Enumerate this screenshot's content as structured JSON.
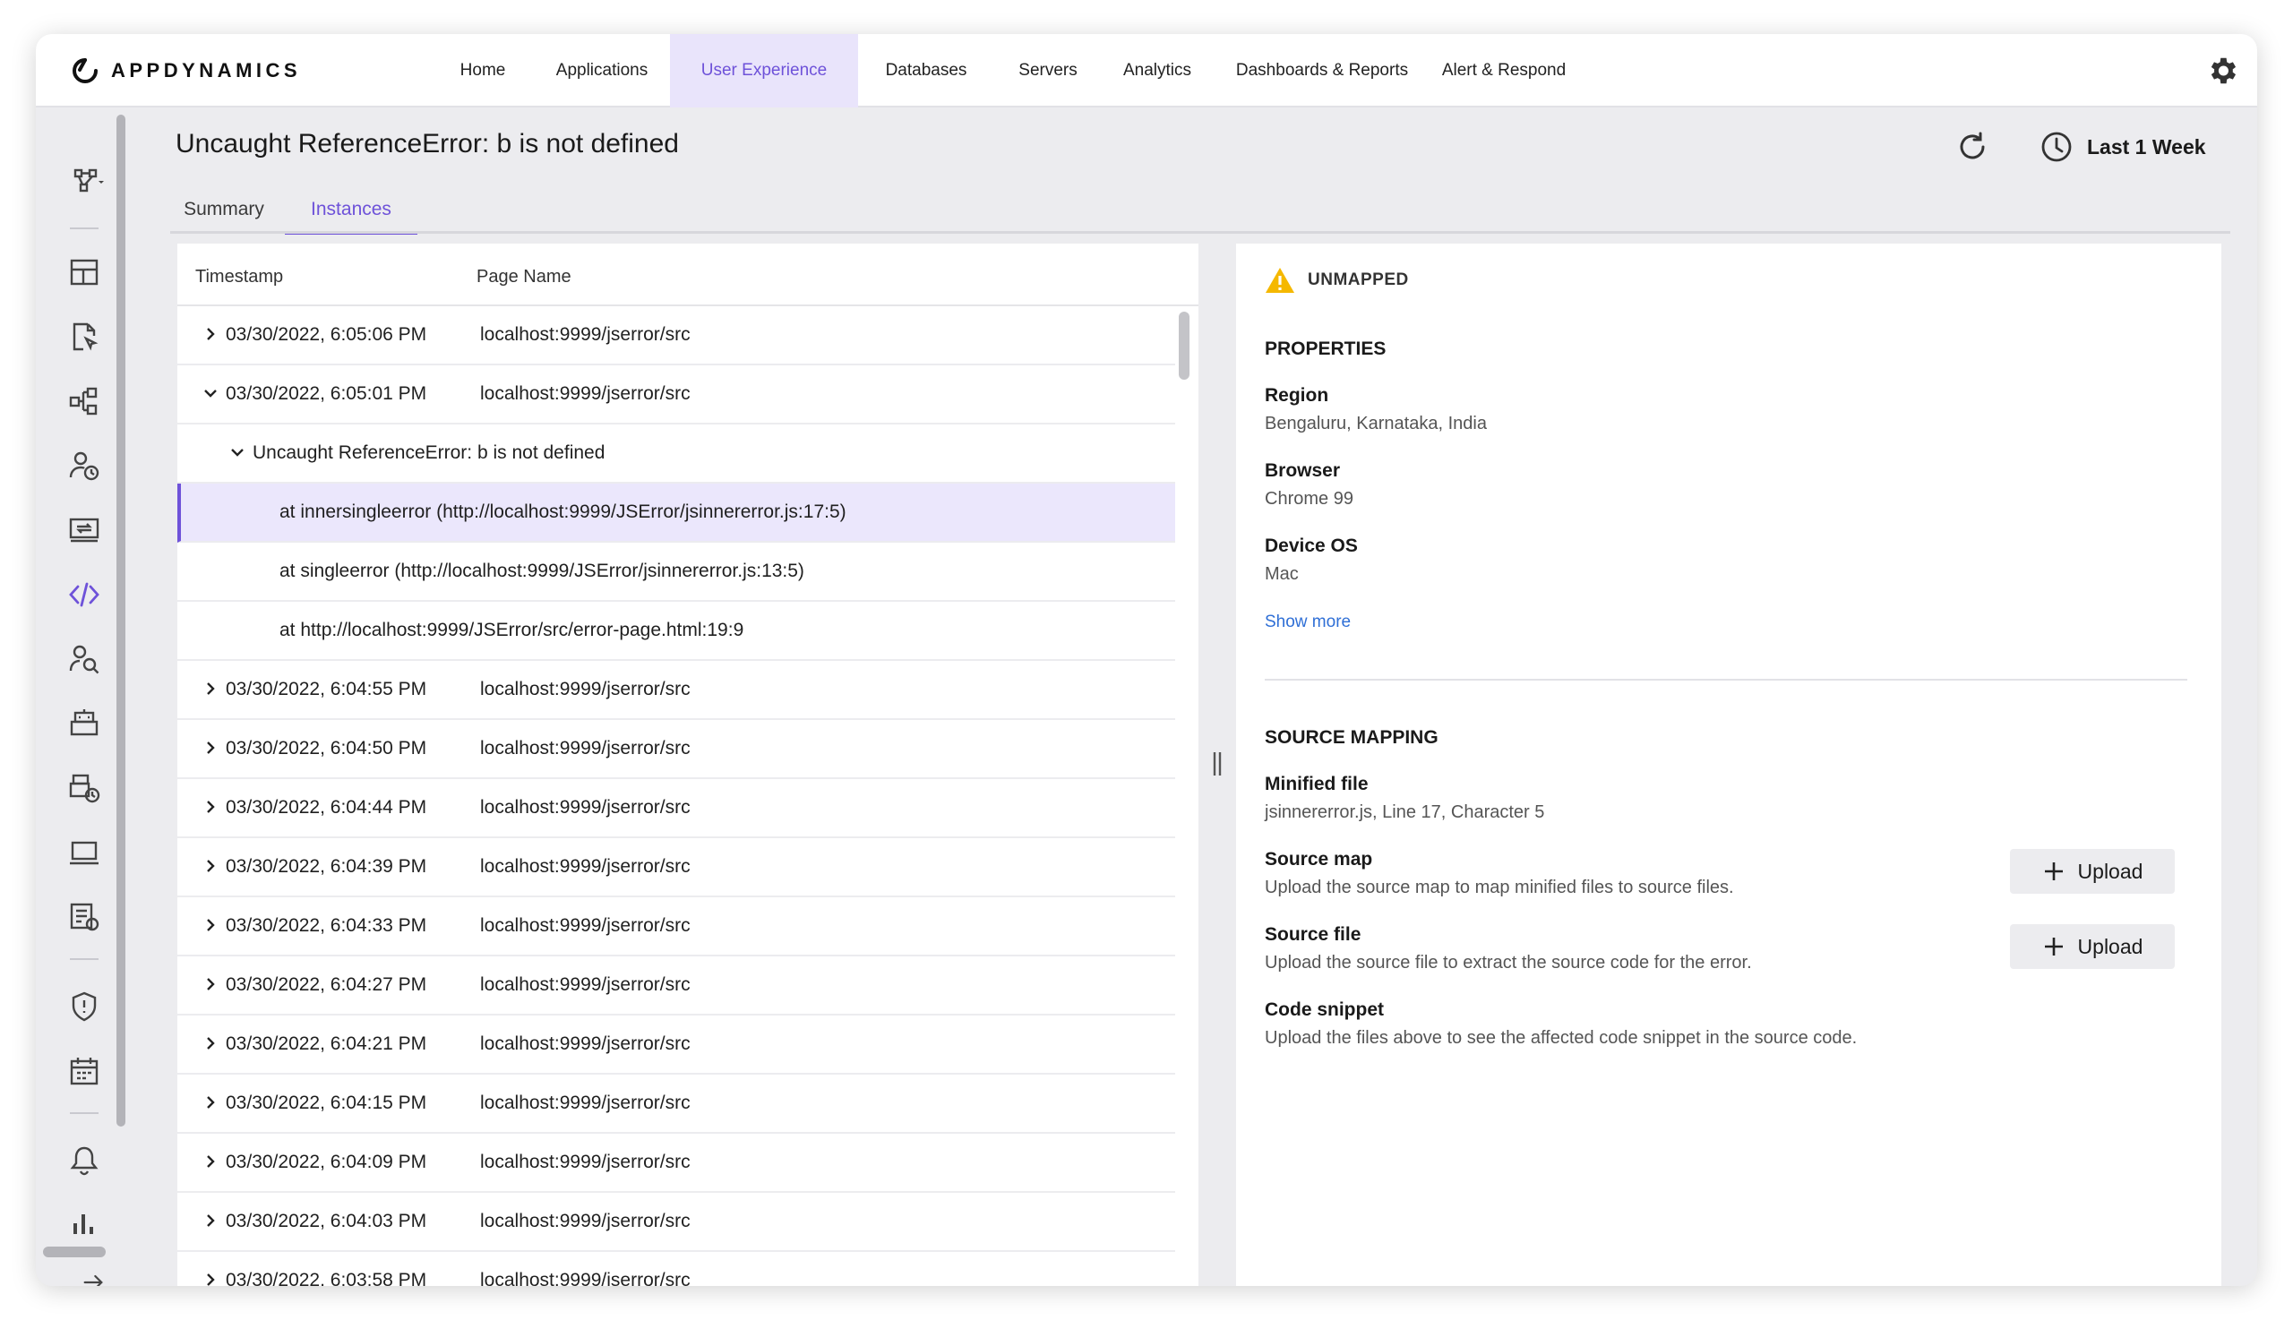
{
  "app": {
    "logo_text": "APPDYNAMICS"
  },
  "nav": {
    "items": [
      {
        "label": "Home"
      },
      {
        "label": "Applications"
      },
      {
        "label": "User Experience"
      },
      {
        "label": "Databases"
      },
      {
        "label": "Servers"
      },
      {
        "label": "Analytics"
      },
      {
        "label": "Dashboards & Reports"
      },
      {
        "label": "Alert & Respond"
      }
    ],
    "active": "User Experience"
  },
  "rail": {
    "icons": [
      "flow-map-icon",
      "dashboard-layout-icon",
      "page-pointer-icon",
      "hierarchy-icon",
      "user-time-icon",
      "screen-switch-icon",
      "code-icon",
      "user-search-icon",
      "robot-icon",
      "robot-time-icon",
      "laptop-icon",
      "report-icon",
      "shield-icon",
      "calendar-icon",
      "alert-bell-icon",
      "bar-chart-icon",
      "expand-arrow-icon"
    ]
  },
  "header": {
    "title": "Uncaught ReferenceError: b is not defined",
    "time_range": "Last 1 Week"
  },
  "tabs": [
    {
      "label": "Summary"
    },
    {
      "label": "Instances"
    }
  ],
  "table": {
    "columns": [
      "Timestamp",
      "Page Name"
    ],
    "rows": [
      {
        "timestamp": "03/30/2022, 6:05:06 PM",
        "page": "localhost:9999/jserror/src"
      },
      {
        "timestamp": "03/30/2022, 6:05:01 PM",
        "page": "localhost:9999/jserror/src"
      },
      {
        "timestamp": "03/30/2022, 6:04:55 PM",
        "page": "localhost:9999/jserror/src"
      },
      {
        "timestamp": "03/30/2022, 6:04:50 PM",
        "page": "localhost:9999/jserror/src"
      },
      {
        "timestamp": "03/30/2022, 6:04:44 PM",
        "page": "localhost:9999/jserror/src"
      },
      {
        "timestamp": "03/30/2022, 6:04:39 PM",
        "page": "localhost:9999/jserror/src"
      },
      {
        "timestamp": "03/30/2022, 6:04:33 PM",
        "page": "localhost:9999/jserror/src"
      },
      {
        "timestamp": "03/30/2022, 6:04:27 PM",
        "page": "localhost:9999/jserror/src"
      },
      {
        "timestamp": "03/30/2022, 6:04:21 PM",
        "page": "localhost:9999/jserror/src"
      },
      {
        "timestamp": "03/30/2022, 6:04:15 PM",
        "page": "localhost:9999/jserror/src"
      },
      {
        "timestamp": "03/30/2022, 6:04:09 PM",
        "page": "localhost:9999/jserror/src"
      },
      {
        "timestamp": "03/30/2022, 6:04:03 PM",
        "page": "localhost:9999/jserror/src"
      },
      {
        "timestamp": "03/30/2022, 6:03:58 PM",
        "page": "localhost:9999/jserror/src"
      }
    ],
    "error_message": "Uncaught ReferenceError: b is not defined",
    "stack": [
      "at innersingleerror (http://localhost:9999/JSError/jsinnererror.js:17:5)",
      "at singleerror (http://localhost:9999/JSError/jsinnererror.js:13:5)",
      "at http://localhost:9999/JSError/src/error-page.html:19:9"
    ]
  },
  "detail": {
    "status": "UNMAPPED",
    "properties_title": "PROPERTIES",
    "properties": [
      {
        "label": "Region",
        "value": "Bengaluru, Karnataka, India"
      },
      {
        "label": "Browser",
        "value": "Chrome 99"
      },
      {
        "label": "Device OS",
        "value": "Mac"
      }
    ],
    "show_more": "Show more",
    "source_mapping_title": "SOURCE MAPPING",
    "minified_file": {
      "label": "Minified file",
      "value": "jsinnererror.js, Line 17, Character 5"
    },
    "source_map": {
      "label": "Source map",
      "value": "Upload the source map to map minified files to source files.",
      "button": "Upload"
    },
    "source_file": {
      "label": "Source file",
      "value": "Upload the source file to extract the source code for the error.",
      "button": "Upload"
    },
    "code_snippet": {
      "label": "Code snippet",
      "value": "Upload the files above to see the affected code snippet in the source code."
    }
  },
  "colors": {
    "accent": "#6e52d9",
    "link": "#2f6fd6",
    "warning": "#f5b800"
  }
}
